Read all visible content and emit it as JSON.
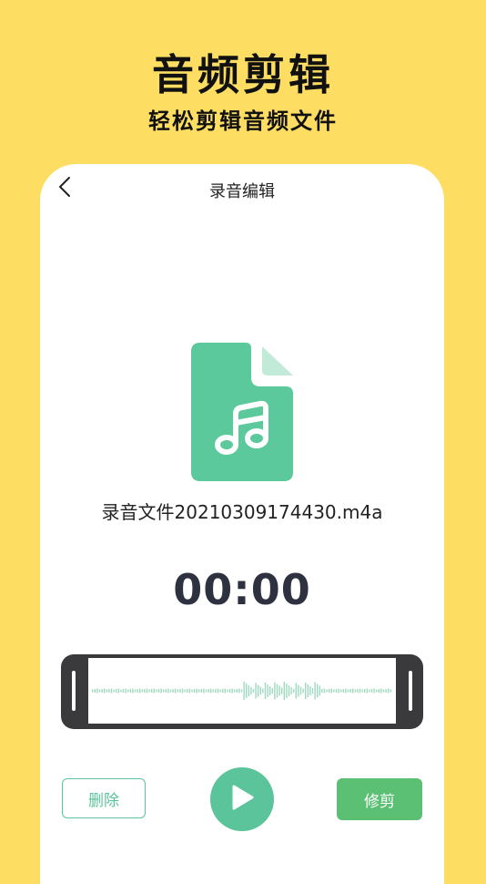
{
  "promo": {
    "title": "音频剪辑",
    "subtitle": "轻松剪辑音频文件"
  },
  "nav": {
    "back_icon": "chevron-left-icon",
    "title": "录音编辑"
  },
  "file": {
    "icon": "music-file-icon",
    "name": "录音文件20210309174430.m4a"
  },
  "player": {
    "time": "00:00",
    "play_icon": "play-icon"
  },
  "actions": {
    "delete_label": "删除",
    "trim_label": "修剪"
  },
  "colors": {
    "background": "#FDDE63",
    "accent": "#5BC49A",
    "trim_button": "#5BC073",
    "waveform": "#9ED9BF",
    "frame": "#3A3A3C"
  }
}
